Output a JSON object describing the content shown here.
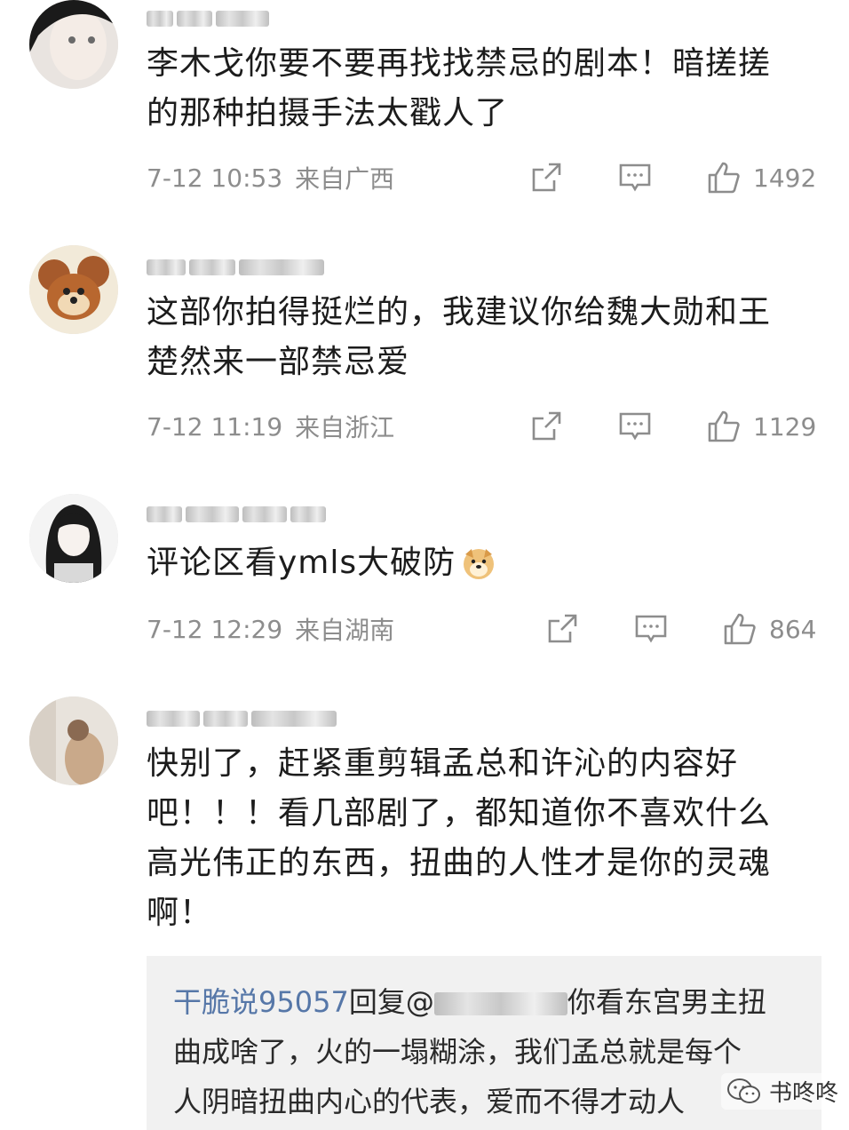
{
  "comments": [
    {
      "name": "",
      "text": "李木戈你要不要再找找禁忌的剧本！暗搓搓\n的那种拍摄手法太戳人了",
      "time": "7-12 10:53",
      "location": "来自广西",
      "likes": "1492"
    },
    {
      "name": "",
      "text": "这部你拍得挺烂的，我建议你给魏大勋和王\n楚然来一部禁忌爱",
      "time": "7-12 11:19",
      "location": "来自浙江",
      "likes": "1129"
    },
    {
      "name": "",
      "text": "评论区看ymls大破防",
      "time": "7-12 12:29",
      "location": "来自湖南",
      "likes": "864"
    },
    {
      "name": "",
      "text": "快别了，赶紧重剪辑孟总和许沁的内容好\n吧！！！看几部剧了，都知道你不喜欢什么\n高光伟正的东西，扭曲的人性才是你的灵魂\n啊！"
    }
  ],
  "reply": {
    "author": "干脆说95057",
    "verb": "回复@",
    "text": "你看东宫男主扭\n曲成啥了，火的一塌糊涂，我们孟总就是每个\n人阴暗扭曲内心的代表，爱而不得才动人"
  },
  "watermark": "书咚咚",
  "icons": [
    "repost-icon",
    "comment-icon",
    "like-icon",
    "doge-emoji-icon",
    "wechat-icon"
  ]
}
